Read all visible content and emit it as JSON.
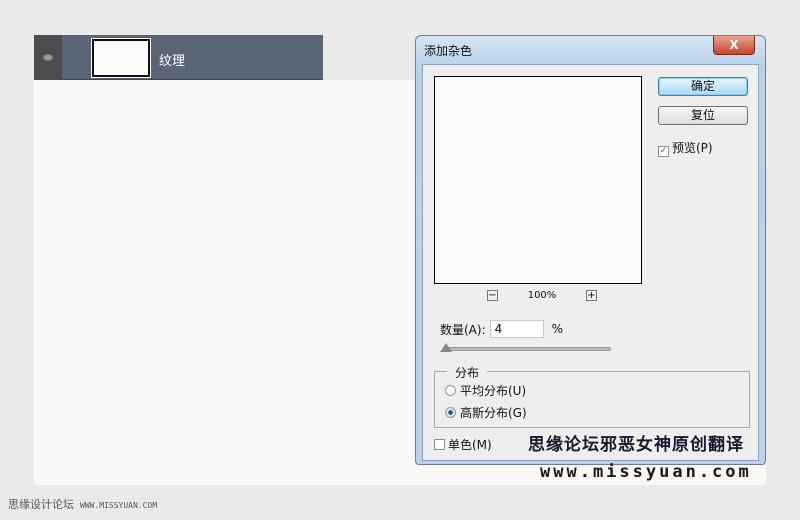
{
  "layer": {
    "name": "纹理"
  },
  "dialog": {
    "title": "添加杂色",
    "close": "X",
    "ok": "确定",
    "reset": "复位",
    "preview": "预览(P)",
    "zoom": "100%",
    "zoom_out": "−",
    "zoom_in": "+",
    "amount_label": "数量(A):",
    "amount_value": "4",
    "amount_unit": "%",
    "amount_slider_value": 4,
    "distribution_label": "分布",
    "uniform": "平均分布(U)",
    "gaussian": "高斯分布(G)",
    "monochrome": "单色(M)"
  },
  "watermark": {
    "line1": "思缘论坛邪恶女神原创翻译",
    "line2": "www.missyuan.com"
  },
  "footer": {
    "site": "思缘设计论坛",
    "url": "WWW.MISSYUAN.COM"
  }
}
